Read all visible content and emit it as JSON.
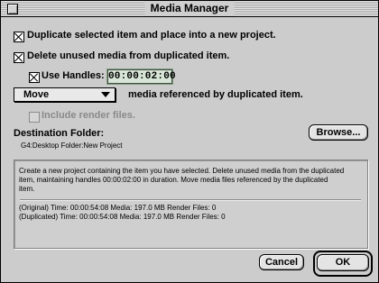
{
  "window": {
    "title": "Media Manager"
  },
  "options": {
    "duplicate_label": "Duplicate selected item and place into a new project.",
    "delete_unused_label": "Delete unused media from duplicated item.",
    "use_handles_label": "Use Handles:",
    "handles_value": "00:00:02:00",
    "action_select": "Move",
    "action_suffix": "media referenced by duplicated item.",
    "include_render_label": "Include render files."
  },
  "destination": {
    "heading": "Destination Folder:",
    "path": "G4:Desktop Folder:New Project",
    "browse_label": "Browse..."
  },
  "summary": {
    "description_lines": [
      "Create a new project containing the item you have selected. Delete unused media from the duplicated",
      "item, maintaining handles 00:00:02:00 in duration. Move media files referenced by the duplicated",
      "item."
    ],
    "original_line": "(Original)  Time: 00:00:54:08      Media: 197.0 MB      Render Files: 0",
    "duplicated_line": "(Duplicated)  Time: 00:00:54:08      Media: 197.0 MB      Render Files: 0"
  },
  "buttons": {
    "cancel_label": "Cancel",
    "ok_label": "OK"
  }
}
